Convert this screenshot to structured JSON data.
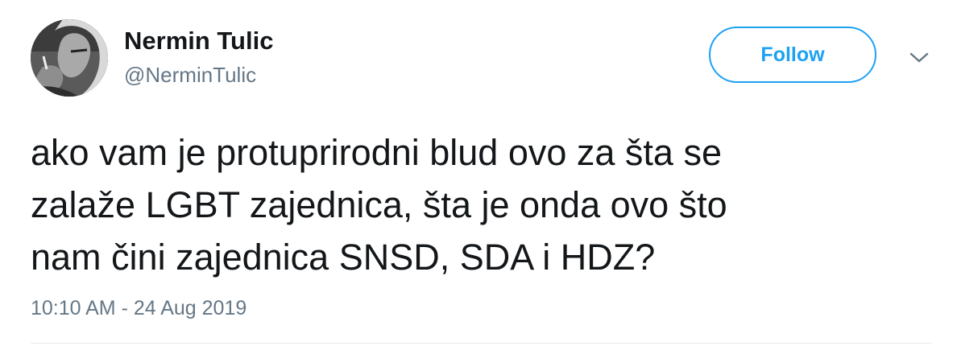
{
  "user": {
    "display_name": "Nermin Tulic",
    "handle": "@NerminTulic"
  },
  "actions": {
    "follow_label": "Follow",
    "more_icon": "chevron-down-icon"
  },
  "tweet": {
    "lines": [
      "ako vam je protuprirodni blud ovo za šta se",
      "zalaže LGBT zajednica, šta je onda ovo što",
      "nam čini zajednica SNSD, SDA i HDZ?"
    ],
    "timestamp": "10:10 AM - 24 Aug 2019"
  },
  "colors": {
    "accent": "#1da1f2",
    "text": "#14171a",
    "muted": "#657786",
    "divider": "#e6ecf0"
  }
}
